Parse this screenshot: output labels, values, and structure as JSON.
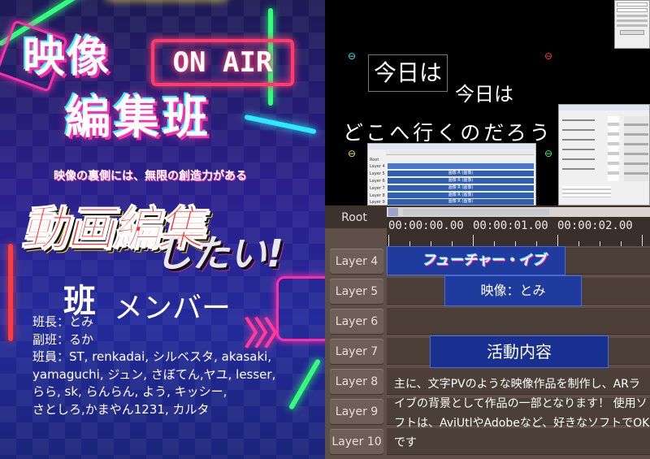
{
  "poster": {
    "title_line1": "映像",
    "title_line2": "編集班",
    "onair": "ON AIR",
    "tagline": "映像の裏側には、無限の創造力がある",
    "headline_part1": "動画編集",
    "headline_part2": "したい!",
    "members_heading_part1": "班",
    "members_heading_part2": "メンバー",
    "members": [
      "班長：とみ",
      "副班：るか",
      "班員：ST, renkadai, シルベスタ, akasaki,",
      "yamaguchi, ジュン, さぼてん,ヤユ, lesser,",
      "らら, sk, らんらん, よう, キッシー,",
      "さとしろ,かまやん1231, カルタ"
    ],
    "chevrons": "〉〉〉"
  },
  "editor_shot": {
    "subtitle_box": "今日は",
    "subtitle_2": "今日は",
    "subtitle_3": "どこへ行くのだろう",
    "mini_timeline_rows": [
      {
        "label": "Root",
        "clip": ""
      },
      {
        "label": "Layer 4",
        "clip": ""
      },
      {
        "label": "Layer 5",
        "clip": "画像 R (画像)"
      },
      {
        "label": "Layer 6",
        "clip": "画像 R (画像)"
      },
      {
        "label": "Layer 7",
        "clip": "画像 R (画像)"
      },
      {
        "label": "Layer 8",
        "clip": "画像 R (画像)"
      },
      {
        "label": "Layer 9",
        "clip": "画像 R (画像)"
      }
    ]
  },
  "timeline": {
    "root_label": "Root",
    "times": [
      "00:00:00.00",
      "00:00:01.00",
      "00:00:02.00"
    ],
    "layers": [
      "Layer 4",
      "Layer 5",
      "Layer 6",
      "Layer 7",
      "Layer 8",
      "Layer 9",
      "Layer 10"
    ],
    "clips": {
      "title": "フューチャー・イブ",
      "credit": "映像：とみ",
      "activity": "活動内容"
    },
    "description": "主に、文字PVのような映像作品を制作し、ARライブの背景として作品の一部となります！ 使用ソフトは、AviUtlやAdobeなど、好きなソフトでOKです"
  },
  "colors": {
    "neon_pink": "#ff2ea8",
    "neon_cyan": "#2ee8ff",
    "clip_blue": "#1f3b9e",
    "timeline_bg": "#5e5048"
  }
}
